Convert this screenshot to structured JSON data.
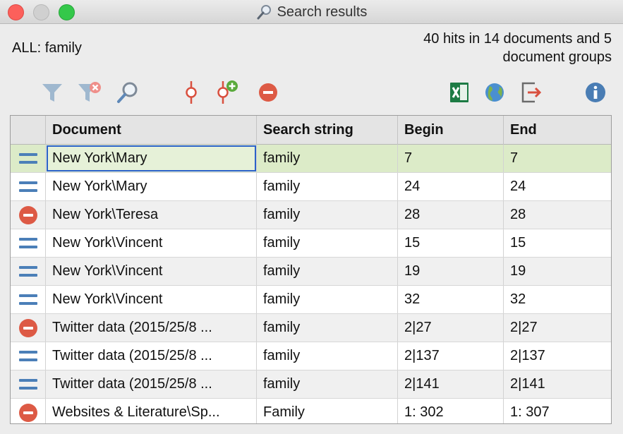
{
  "window": {
    "title": "Search results"
  },
  "summary": {
    "query": "ALL: family",
    "hits_line1": "40 hits in 14 documents and 5",
    "hits_line2": "document groups"
  },
  "toolbar": {
    "icons": [
      "filter-icon",
      "remove-filter-icon",
      "search-icon",
      "activate-icon",
      "activate-add-icon",
      "deactivate-icon",
      "excel-export-icon",
      "globe-icon",
      "export-icon",
      "info-icon"
    ]
  },
  "table": {
    "columns": [
      "Document",
      "Search string",
      "Begin",
      "End"
    ],
    "rows": [
      {
        "status": "active",
        "document": "New York\\Mary",
        "search_string": "family",
        "begin": "7",
        "end": "7"
      },
      {
        "status": "active",
        "document": "New York\\Mary",
        "search_string": "family",
        "begin": "24",
        "end": "24"
      },
      {
        "status": "inactive",
        "document": "New York\\Teresa",
        "search_string": "family",
        "begin": "28",
        "end": "28"
      },
      {
        "status": "active",
        "document": "New York\\Vincent",
        "search_string": "family",
        "begin": "15",
        "end": "15"
      },
      {
        "status": "active",
        "document": "New York\\Vincent",
        "search_string": "family",
        "begin": "19",
        "end": "19"
      },
      {
        "status": "active",
        "document": "New York\\Vincent",
        "search_string": "family",
        "begin": "32",
        "end": "32"
      },
      {
        "status": "inactive",
        "document": "Twitter data (2015/25/8 ...",
        "search_string": "family",
        "begin": "2|27",
        "end": "2|27"
      },
      {
        "status": "active",
        "document": "Twitter data (2015/25/8 ...",
        "search_string": "family",
        "begin": "2|137",
        "end": "2|137"
      },
      {
        "status": "active",
        "document": "Twitter data (2015/25/8 ...",
        "search_string": "family",
        "begin": "2|141",
        "end": "2|141"
      },
      {
        "status": "inactive",
        "document": "Websites & Literature\\Sp...",
        "search_string": "Family",
        "begin": "1: 302",
        "end": "1: 307"
      }
    ]
  },
  "colors": {
    "selected_row": "#dcebc8",
    "active_icon": "#4b7fb8",
    "inactive_icon": "#dd5a45",
    "focus_outline": "#2b62c9"
  }
}
